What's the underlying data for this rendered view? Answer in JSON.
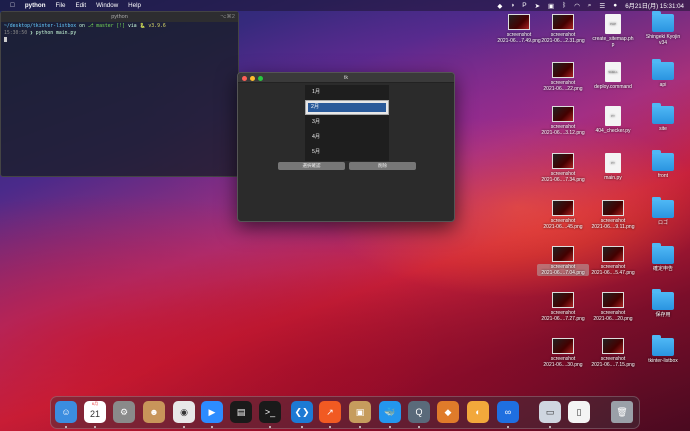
{
  "menubar": {
    "apple_icon": "apple-logo-icon",
    "app_name": "python",
    "items": [
      "File",
      "Edit",
      "Window",
      "Help"
    ],
    "status_icons": [
      "dropbox-icon",
      "contrast-icon",
      "p-icon",
      "cursor-icon",
      "screenshot-icon",
      "bluetooth-icon",
      "wifi-icon",
      "search-icon",
      "control-center-icon",
      "siri-icon"
    ],
    "clock": "6月21日(月)  15:31:04"
  },
  "terminal": {
    "title": "python",
    "shortcut": "⌥⌘2",
    "line1_path": "~/desktop/tkinter-listbox",
    "line1_on": " on ",
    "line1_branch": "master [!]",
    "line1_via": " via ",
    "line1_version": "v3.9.6",
    "line2_time": "15:30:50",
    "line2_cmd": " ❯ python main.py"
  },
  "tk_window": {
    "title": "tk",
    "list_items": [
      "1月",
      "2月",
      "3月",
      "4月",
      "5月"
    ],
    "selected_index": 1,
    "button_confirm": "選択確認",
    "button_delete": "削除"
  },
  "desktop_icons": {
    "col1": [
      {
        "label1": "screenshot",
        "label2": "2021-06....7.49.png"
      }
    ],
    "col2": [
      {
        "label1": "screenshot",
        "label2": "2021-06....2.31.png"
      },
      {
        "label1": "screenshot",
        "label2": "2021-06....22.png"
      },
      {
        "label1": "screenshot",
        "label2": "2021-06....3.12.png"
      },
      {
        "label1": "screenshot",
        "label2": "2021-06....7.34.png"
      },
      {
        "label1": "screenshot",
        "label2": "2021-06....45.png"
      },
      {
        "label1": "screenshot",
        "label2": "2021-06....7.04.png"
      },
      {
        "label1": "screenshot",
        "label2": "2021-06....7.27.png"
      },
      {
        "label1": "screenshot",
        "label2": "2021-06....30.png"
      }
    ],
    "col3": [
      {
        "label1": "create_sitemap.ph",
        "label2": "p",
        "type": "doc",
        "badge": "PHP"
      },
      {
        "label1": "deploy.command",
        "label2": "",
        "type": "doc",
        "badge": "SHELL"
      },
      {
        "label1": "404_checker.py",
        "label2": "",
        "type": "doc",
        "badge": "PY"
      },
      {
        "label1": "main.py",
        "label2": "",
        "type": "doc",
        "badge": "PY"
      },
      {
        "label1": "screenshot",
        "label2": "2021-06....9.11.png",
        "type": "thumb"
      },
      {
        "label1": "screenshot",
        "label2": "2021-06....5.47.png",
        "type": "thumb"
      },
      {
        "label1": "screenshot",
        "label2": "2021-06....20.png",
        "type": "thumb"
      },
      {
        "label1": "screenshot",
        "label2": "2021-06....7.15.png",
        "type": "thumb"
      }
    ],
    "col4": [
      {
        "label1": "Shingeki Kyojin",
        "label2": "v34"
      },
      {
        "label1": "api",
        "label2": ""
      },
      {
        "label1": "site",
        "label2": ""
      },
      {
        "label1": "front",
        "label2": ""
      },
      {
        "label1": "ロゴ",
        "label2": ""
      },
      {
        "label1": "確定申告",
        "label2": ""
      },
      {
        "label1": "保存用",
        "label2": ""
      },
      {
        "label1": "tkinter-listbox",
        "label2": ""
      }
    ]
  },
  "dock": {
    "items": [
      {
        "name": "finder-icon",
        "glyph": "☺",
        "color": "#3b8de0"
      },
      {
        "name": "calendar-icon",
        "glyph": "21",
        "color": "#ffffff"
      },
      {
        "name": "system-preferences-icon",
        "glyph": "⚙",
        "color": "#8a8a8a"
      },
      {
        "name": "contacts-icon",
        "glyph": "☻",
        "color": "#c8955a"
      },
      {
        "name": "chrome-icon",
        "glyph": "◉",
        "color": "#e8e8e8"
      },
      {
        "name": "zoom-icon",
        "glyph": "▶",
        "color": "#2d8cff"
      },
      {
        "name": "activity-monitor-icon",
        "glyph": "▤",
        "color": "#1a1a1a"
      },
      {
        "name": "terminal-icon",
        "glyph": ">_",
        "color": "#1a1a1a"
      },
      {
        "name": "vscode-icon",
        "glyph": "❮❯",
        "color": "#1d7ad4"
      },
      {
        "name": "analytics-icon",
        "glyph": "↗",
        "color": "#f15a22"
      },
      {
        "name": "archive-utility-icon",
        "glyph": "▣",
        "color": "#c69c5d"
      },
      {
        "name": "docker-icon",
        "glyph": "🐳",
        "color": "#2496ed"
      },
      {
        "name": "quicktime-icon",
        "glyph": "Q",
        "color": "#5a6a7a"
      },
      {
        "name": "sourcetree-icon",
        "glyph": "◆",
        "color": "#e07b2a"
      },
      {
        "name": "sketch-icon",
        "glyph": "◐",
        "color": "#f2a83b"
      },
      {
        "name": "infinity-icon",
        "glyph": "∞",
        "color": "#1f6fe0"
      },
      {
        "name": "preview-icon",
        "glyph": "▭",
        "color": "#cfd6e0"
      },
      {
        "name": "document-icon",
        "glyph": "▯",
        "color": "#f4f4f4"
      },
      {
        "name": "trash-icon",
        "glyph": "🗑",
        "color": "#9aa0a8"
      }
    ],
    "calendar_month": "6月"
  }
}
